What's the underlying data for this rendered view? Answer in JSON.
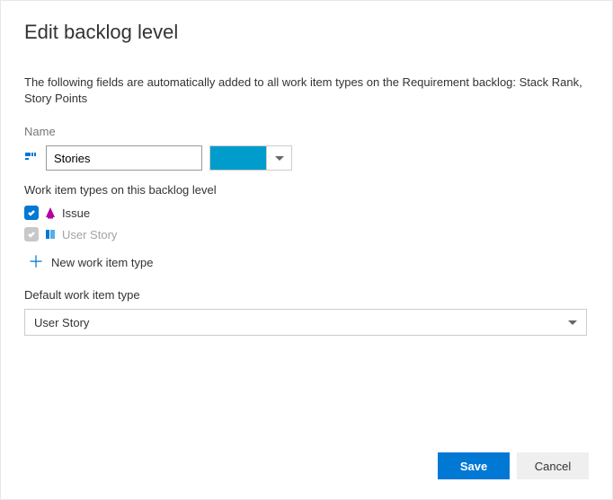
{
  "title": "Edit backlog level",
  "description": "The following fields are automatically added to all work item types on the Requirement backlog: Stack Rank, Story Points",
  "name": {
    "label": "Name",
    "value": "Stories",
    "color": "#009ccc"
  },
  "workItemTypes": {
    "heading": "Work item types on this backlog level",
    "items": [
      {
        "label": "Issue",
        "checked": true,
        "disabled": false,
        "iconColor": "#b4009e"
      },
      {
        "label": "User Story",
        "checked": true,
        "disabled": true,
        "iconColor": "#0078d4"
      }
    ],
    "newLabel": "New work item type"
  },
  "defaultType": {
    "label": "Default work item type",
    "value": "User Story"
  },
  "buttons": {
    "save": "Save",
    "cancel": "Cancel"
  }
}
